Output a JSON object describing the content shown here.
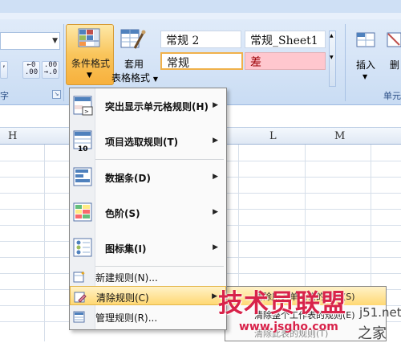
{
  "ribbon": {
    "font_group_label": "字",
    "conditional_format_label": "条件格式",
    "table_format_label_1": "套用",
    "table_format_label_2": "表格格式",
    "insert_label": "插入",
    "delete_label": "删",
    "cells_group_label": "单元",
    "increase_decimal": "←0\n.00",
    "decrease_decimal": ".00\n→.0",
    "styles": {
      "style1": "常规 2",
      "style2": "常规_Sheet1",
      "style3": "常规",
      "style4": "差"
    }
  },
  "columns": [
    "H",
    "L",
    "M"
  ],
  "menu": {
    "items": [
      {
        "label": "突出显示单元格规则(H)"
      },
      {
        "label": "项目选取规则(T)"
      },
      {
        "label": "数据条(D)"
      },
      {
        "label": "色阶(S)"
      },
      {
        "label": "图标集(I)"
      }
    ],
    "new_rule": "新建规则(N)...",
    "clear_rules": "清除规则(C)",
    "manage_rules": "管理规则(R)..."
  },
  "submenu": {
    "item1": "清除所选单元格的规则(S)",
    "item2": "清除整个工作表的规则(E)",
    "item3": "清除此表的规则(T)"
  },
  "watermark": {
    "brand": "技术员联盟",
    "site_short": "j51.net",
    "url": "www.jsgho.com",
    "suffix": "之家"
  },
  "colors": {
    "accent": "#f7b03c",
    "bad_style_fill": "#ffc7ce",
    "bad_style_text": "#9c0006",
    "watermark": "#d8234a"
  }
}
